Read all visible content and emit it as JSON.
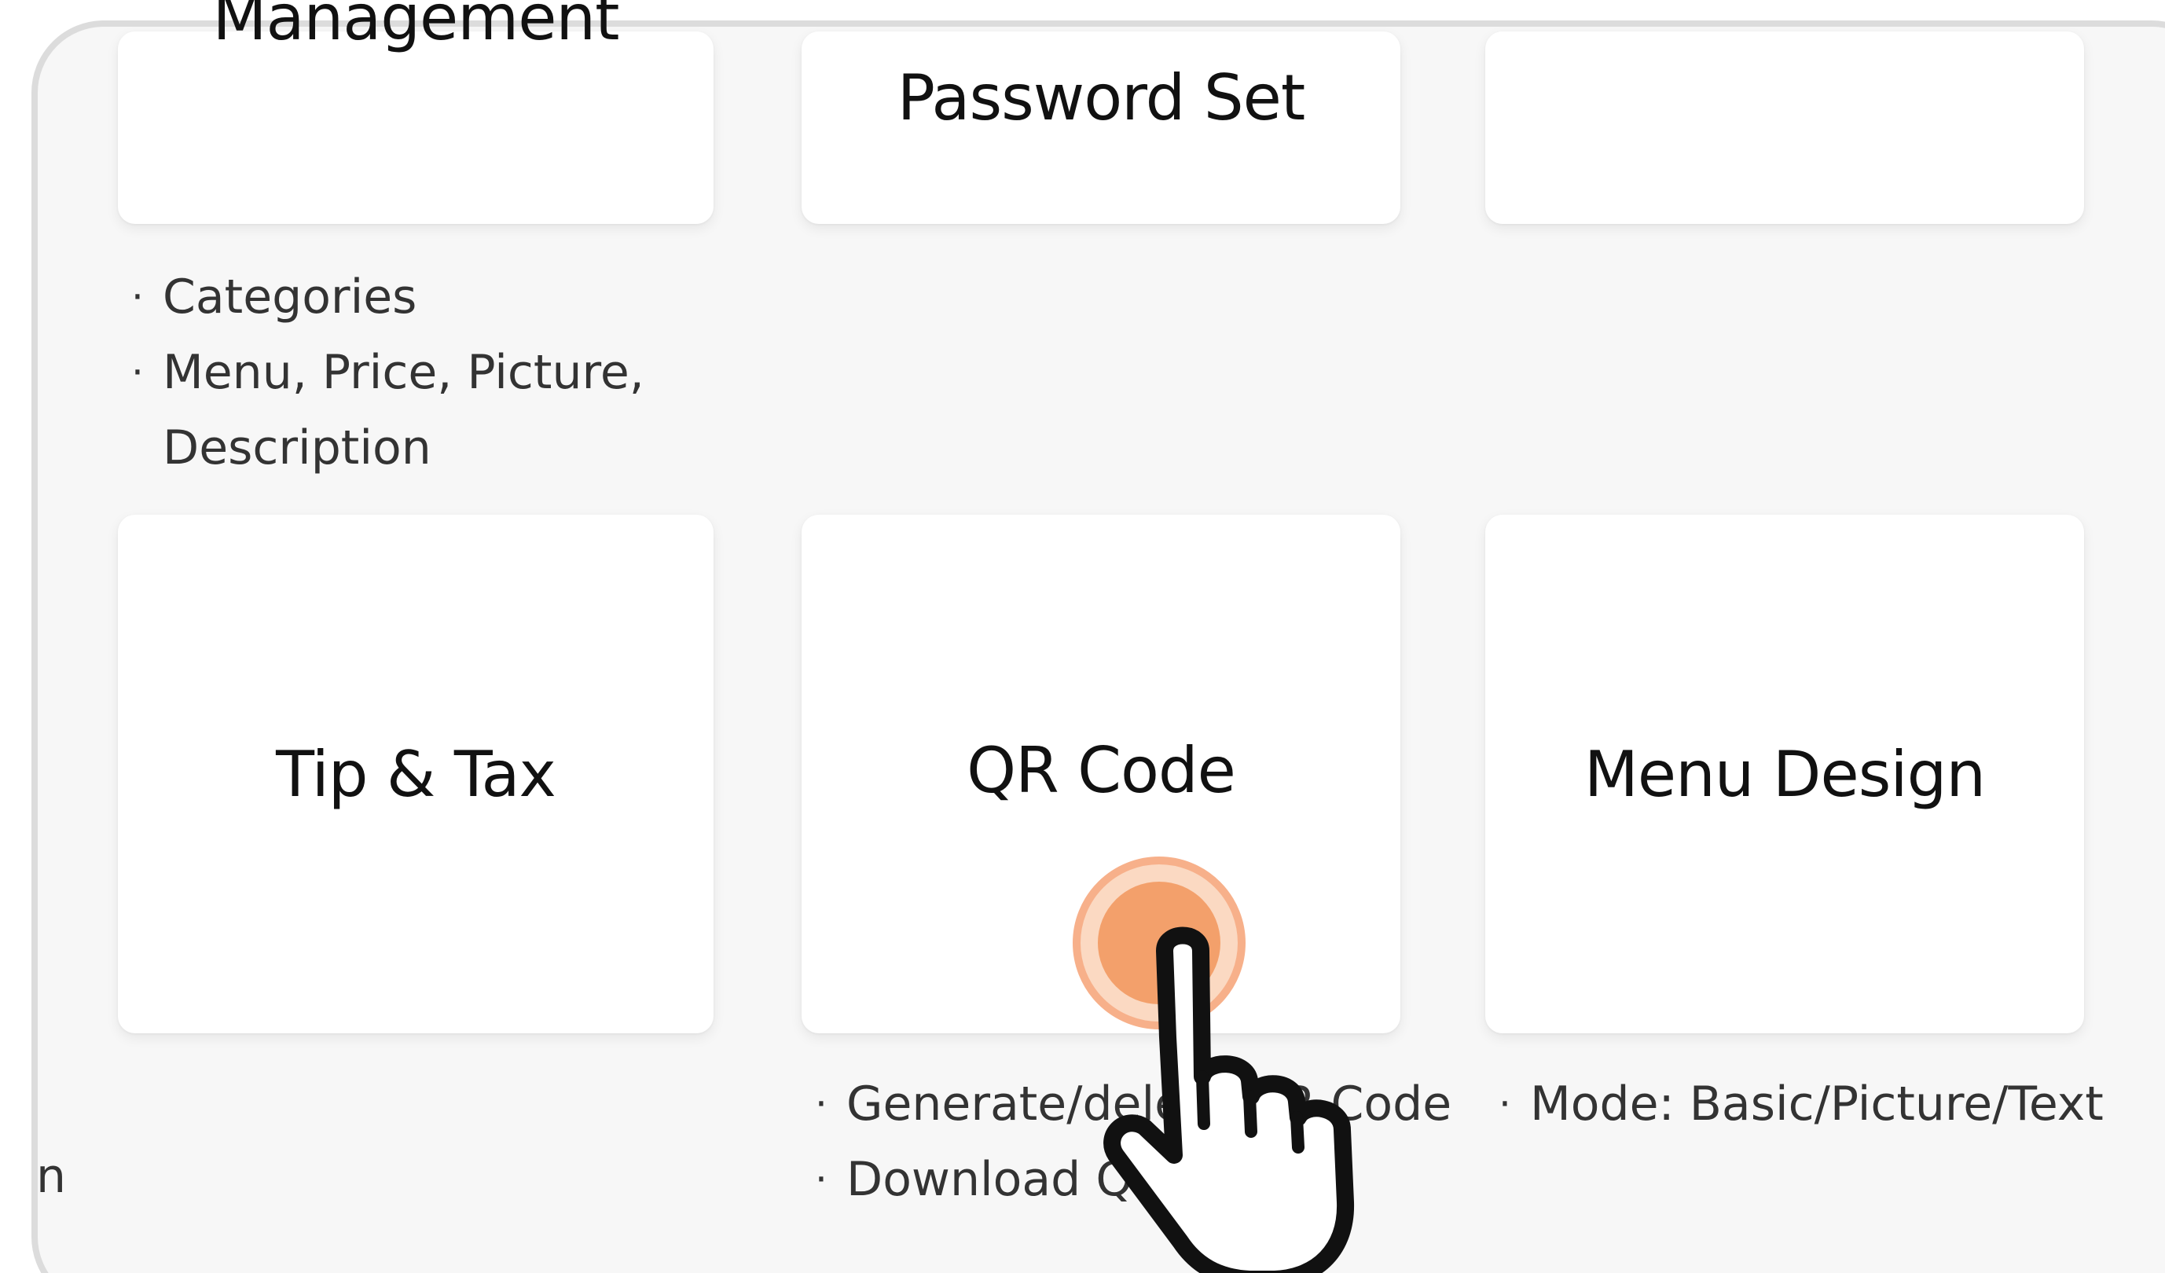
{
  "cards_row1": {
    "menu_management": {
      "title": "Management"
    },
    "password_set": {
      "title": "Password Set"
    },
    "third": {
      "title": ""
    }
  },
  "menu_management_features": [
    "Categories",
    "Menu, Price, Picture,",
    "Description"
  ],
  "cards_row2": {
    "tip_tax": {
      "title": "Tip & Tax"
    },
    "qr_code": {
      "title": "QR Code"
    },
    "menu_design": {
      "title": "Menu Design"
    }
  },
  "qr_code_features": [
    "Generate/delete QR Code",
    "Download QR"
  ],
  "menu_design_features": [
    "Mode: Basic/Picture/Text"
  ],
  "bullet": "·",
  "edge_text": "n",
  "colors": {
    "panel_bg": "#f7f7f7",
    "panel_border": "#dcdcdc",
    "card_bg": "#ffffff",
    "tap_ring": "#f7b58a",
    "tap_core": "#f3a06b"
  },
  "icons": {
    "tap": "tap-ripple-icon",
    "hand": "pointing-hand-icon"
  }
}
